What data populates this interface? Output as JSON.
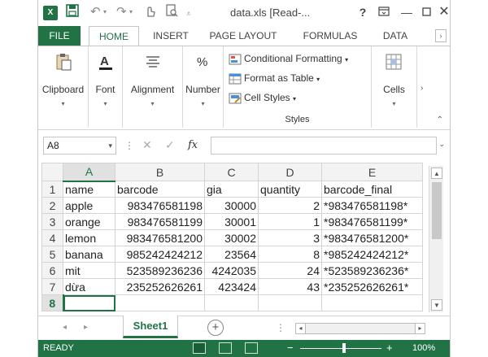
{
  "titlebar": {
    "app_logo": "X",
    "title": "data.xls  [Read-...",
    "help": "?",
    "icons": [
      "excel-logo-icon",
      "save-icon",
      "undo-icon",
      "redo-icon",
      "touch-mode-icon",
      "print-preview-icon",
      "customize-qat-icon",
      "help-icon",
      "ribbon-display-icon",
      "minimize-icon",
      "maximize-icon",
      "close-icon"
    ]
  },
  "tabs": [
    "FILE",
    "HOME",
    "INSERT",
    "PAGE LAYOUT",
    "FORMULAS",
    "DATA"
  ],
  "active_tab": "HOME",
  "ribbon": {
    "clipboard": "Clipboard",
    "font": "Font",
    "alignment": "Alignment",
    "number": "Number",
    "conditional_formatting": "Conditional Formatting",
    "format_as_table": "Format as Table",
    "cell_styles": "Cell Styles",
    "styles_group": "Styles",
    "cells": "Cells"
  },
  "formula_bar": {
    "name_box": "A8",
    "fx": "fx",
    "value": ""
  },
  "sheet": {
    "columns": [
      "A",
      "B",
      "C",
      "D",
      "E"
    ],
    "selected_column": "A",
    "selected_row": "8",
    "rows": [
      {
        "n": "1",
        "cells": [
          "name",
          "barcode",
          "gia",
          "quantity",
          "barcode_final"
        ]
      },
      {
        "n": "2",
        "cells": [
          "apple",
          "983476581198",
          "30000",
          "2",
          "*983476581198*"
        ]
      },
      {
        "n": "3",
        "cells": [
          "orange",
          "983476581199",
          "30001",
          "1",
          "*983476581199*"
        ]
      },
      {
        "n": "4",
        "cells": [
          "lemon",
          "983476581200",
          "30002",
          "3",
          "*983476581200*"
        ]
      },
      {
        "n": "5",
        "cells": [
          "banana",
          "985242424212",
          "23564",
          "8",
          "*985242424212*"
        ]
      },
      {
        "n": "6",
        "cells": [
          "mit",
          "523589236236",
          "4242035",
          "24",
          "*523589236236*"
        ]
      },
      {
        "n": "7",
        "cells": [
          "dừa",
          "235252626261",
          "423424",
          "43",
          "*235252626261*"
        ]
      },
      {
        "n": "8",
        "cells": [
          "",
          "",
          "",
          "",
          ""
        ]
      }
    ]
  },
  "sheet_tabs": {
    "active": "Sheet1",
    "add": "+"
  },
  "status": {
    "mode": "READY",
    "zoom": "100%",
    "zoom_level_percent": 100
  },
  "colors": {
    "accent": "#217346"
  }
}
